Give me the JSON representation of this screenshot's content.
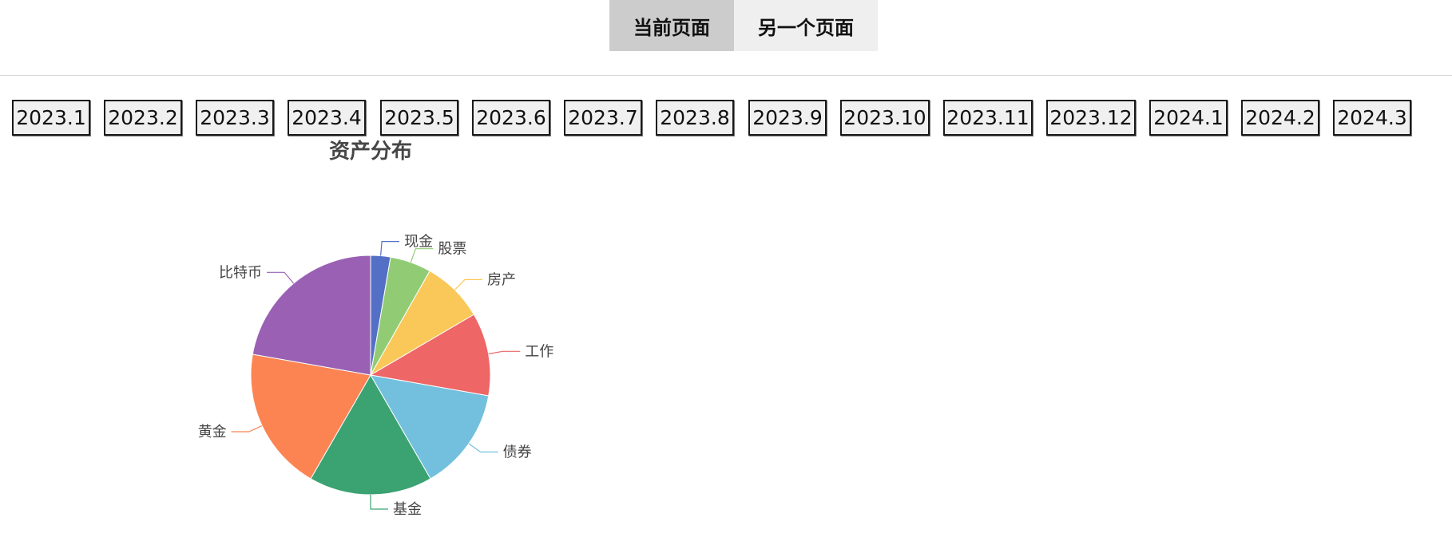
{
  "tabs": [
    {
      "label": "当前页面",
      "active": true
    },
    {
      "label": "另一个页面",
      "active": false
    }
  ],
  "dates": [
    "2023.1",
    "2023.2",
    "2023.3",
    "2023.4",
    "2023.5",
    "2023.6",
    "2023.7",
    "2023.8",
    "2023.9",
    "2023.10",
    "2023.11",
    "2023.12",
    "2024.1",
    "2024.2",
    "2024.3"
  ],
  "chart_data": {
    "type": "pie",
    "title": "资产分布",
    "slices": [
      {
        "name": "现金",
        "value": 2.5,
        "color": "#5470c6"
      },
      {
        "name": "股票",
        "value": 5.2,
        "color": "#91cc75"
      },
      {
        "name": "房产",
        "value": 7.8,
        "color": "#fac858"
      },
      {
        "name": "工作",
        "value": 10.5,
        "color": "#ee6666"
      },
      {
        "name": "债券",
        "value": 13.0,
        "color": "#73c0de"
      },
      {
        "name": "基金",
        "value": 15.6,
        "color": "#3ba272"
      },
      {
        "name": "黄金",
        "value": 18.2,
        "color": "#fc8452"
      },
      {
        "name": "比特币",
        "value": 20.8,
        "color": "#9a60b4"
      }
    ]
  }
}
